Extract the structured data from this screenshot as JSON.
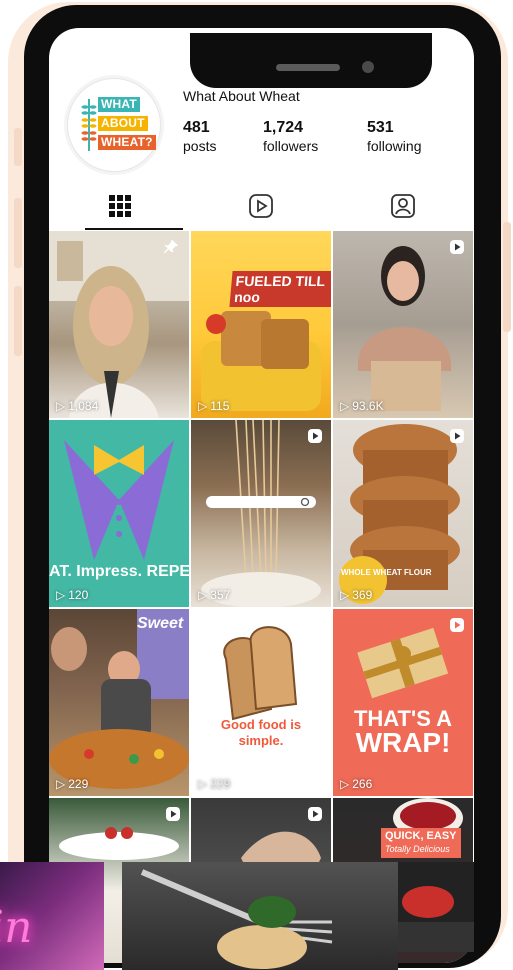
{
  "profile": {
    "username": "What About Wheat",
    "logo_words": [
      "WHAT",
      "ABOUT",
      "WHEAT?"
    ],
    "stats": [
      {
        "num": "481",
        "label": "posts"
      },
      {
        "num": "1,724",
        "label": "followers"
      },
      {
        "num": "531",
        "label": "following"
      }
    ]
  },
  "tabs": [
    {
      "name": "grid",
      "icon": "grid-icon"
    },
    {
      "name": "reels",
      "icon": "reels-icon"
    },
    {
      "name": "tagged",
      "icon": "tagged-icon"
    }
  ],
  "posts": [
    {
      "views": "1,084",
      "pinned": true,
      "reel": false
    },
    {
      "views": "115",
      "overlay": "FUELED TILL noo",
      "reel": false
    },
    {
      "views": "93.6K",
      "reel": true
    },
    {
      "views": "120",
      "overlay": "AT. Impress. REPEA",
      "reel": false
    },
    {
      "views": "357",
      "reel": true
    },
    {
      "views": "369",
      "overlay": "WHOLE WHEAT FLOUR",
      "reel": true
    },
    {
      "views": "229",
      "overlay": "Sweet",
      "reel": false
    },
    {
      "views": "229",
      "overlay_line1": "Good food is",
      "overlay_line2": "simple.",
      "reel": false
    },
    {
      "views": "266",
      "overlay_line1": "THAT'S A",
      "overlay_line2": "WRAP!",
      "reel": true
    },
    {
      "reel": true
    },
    {
      "reel": true
    },
    {
      "overlay_line1": "QUICK, EASY",
      "overlay_line2": "Totally Delicious"
    }
  ],
  "colors": {
    "frame": "#0d0d0d",
    "frame_accent": "#fbe9dc",
    "logo_teal": "#3ab5b3",
    "logo_yellow": "#f4b400",
    "logo_orange": "#e8622c",
    "coral": "#ef6b57"
  },
  "decorations": {
    "neon_text": "in"
  }
}
